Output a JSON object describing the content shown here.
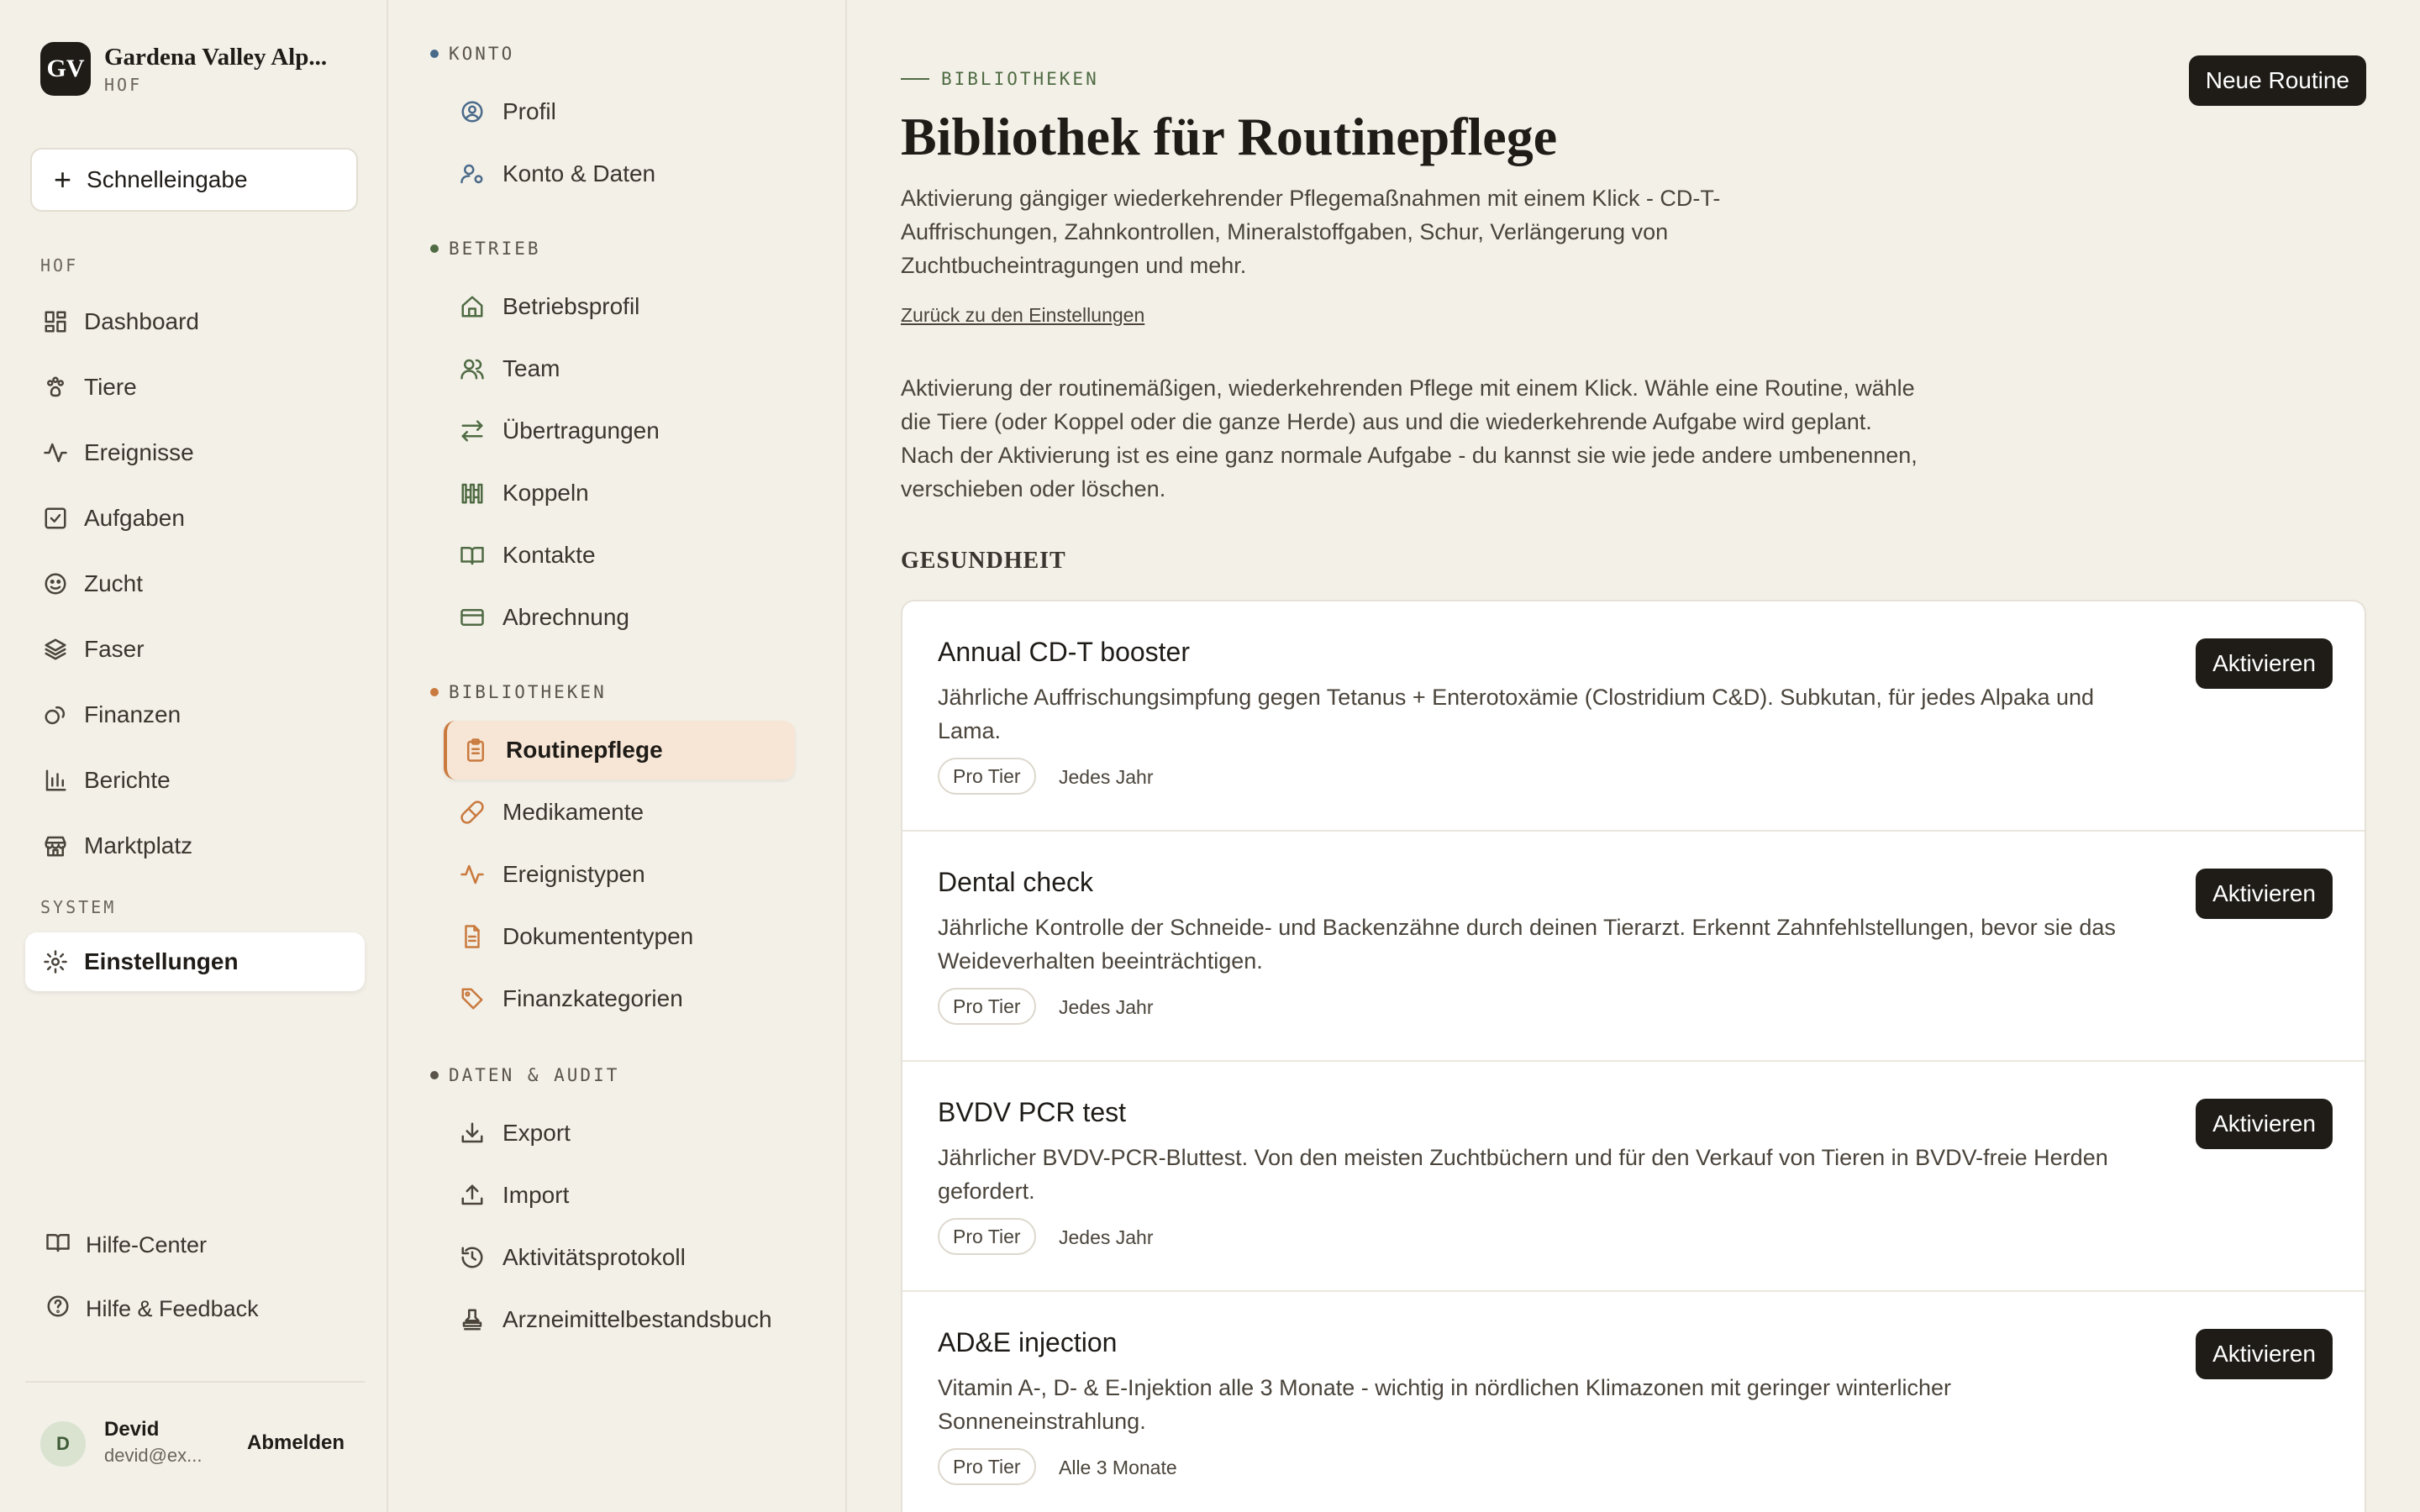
{
  "brand": {
    "initials": "GV",
    "name": "Gardena Valley Alp...",
    "sub": "HOF"
  },
  "quick_entry": {
    "label": "Schnelleingabe"
  },
  "sidebar": {
    "section_hof": "HOF",
    "items": [
      {
        "label": "Dashboard",
        "icon": "dashboard-icon"
      },
      {
        "label": "Tiere",
        "icon": "paw-icon"
      },
      {
        "label": "Ereignisse",
        "icon": "activity-icon"
      },
      {
        "label": "Aufgaben",
        "icon": "checkbox-icon"
      },
      {
        "label": "Zucht",
        "icon": "breeding-icon"
      },
      {
        "label": "Faser",
        "icon": "layers-icon"
      },
      {
        "label": "Finanzen",
        "icon": "coins-icon"
      },
      {
        "label": "Berichte",
        "icon": "bar-chart-icon"
      },
      {
        "label": "Marktplatz",
        "icon": "store-icon"
      }
    ],
    "section_system": "SYSTEM",
    "settings_label": "Einstellungen",
    "help_center": "Hilfe-Center",
    "help_feedback": "Hilfe & Feedback"
  },
  "user": {
    "initial": "D",
    "name": "Devid",
    "email": "devid@ex...",
    "logout": "Abmelden"
  },
  "subnav": {
    "konto": "KONTO",
    "konto_items": [
      "Profil",
      "Konto & Daten"
    ],
    "betrieb": "BETRIEB",
    "betrieb_items": [
      "Betriebsprofil",
      "Team",
      "Übertragungen",
      "Koppeln",
      "Kontakte",
      "Abrechnung"
    ],
    "bibliotheken": "BIBLIOTHEKEN",
    "bibliotheken_items": [
      "Routinepflege",
      "Medikamente",
      "Ereignistypen",
      "Dokumententypen",
      "Finanzkategorien"
    ],
    "daten": "DATEN & AUDIT",
    "daten_items": [
      "Export",
      "Import",
      "Aktivitätsprotokoll",
      "Arzneimittelbestandsbuch"
    ]
  },
  "main": {
    "eyebrow": "BIBLIOTHEKEN",
    "title": "Bibliothek für Routinepflege",
    "new_button": "Neue Routine",
    "intro": "Aktivierung gängiger wiederkehrender Pflegemaßnahmen mit einem Klick - CD-T-Auffrischungen, Zahnkontrollen, Mineralstoffgaben, Schur, Verlängerung von Zuchtbucheintragungen und mehr.",
    "back_link": "Zurück zu den Einstellungen",
    "description": "Aktivierung der routinemäßigen, wiederkehrenden Pflege mit einem Klick. Wähle eine Routine, wähle die Tiere (oder Koppel oder die ganze Herde) aus und die wiederkehrende Aufgabe wird geplant. Nach der Aktivierung ist es eine ganz normale Aufgabe - du kannst sie wie jede andere umbenennen, verschieben oder löschen.",
    "group": "GESUNDHEIT",
    "activate_label": "Aktivieren",
    "routines": [
      {
        "title": "Annual CD-T booster",
        "text": "Jährliche Auffrischungsimpfung gegen Tetanus + Enterotoxämie (Clostridium C&D). Subkutan, für jedes Alpaka und Lama.",
        "scope": "Pro Tier",
        "frequency": "Jedes Jahr"
      },
      {
        "title": "Dental check",
        "text": "Jährliche Kontrolle der Schneide- und Backenzähne durch deinen Tierarzt. Erkennt Zahnfehlstellungen, bevor sie das Weideverhalten beeinträchtigen.",
        "scope": "Pro Tier",
        "frequency": "Jedes Jahr"
      },
      {
        "title": "BVDV PCR test",
        "text": "Jährlicher BVDV-PCR-Bluttest. Von den meisten Zuchtbüchern und für den Verkauf von Tieren in BVDV-freie Herden gefordert.",
        "scope": "Pro Tier",
        "frequency": "Jedes Jahr"
      },
      {
        "title": "AD&E injection",
        "text": "Vitamin A-, D- & E-Injektion alle 3 Monate - wichtig in nördlichen Klimazonen mit geringer winterlicher Sonneneinstrahlung.",
        "scope": "Pro Tier",
        "frequency": "Alle 3 Monate"
      }
    ]
  }
}
